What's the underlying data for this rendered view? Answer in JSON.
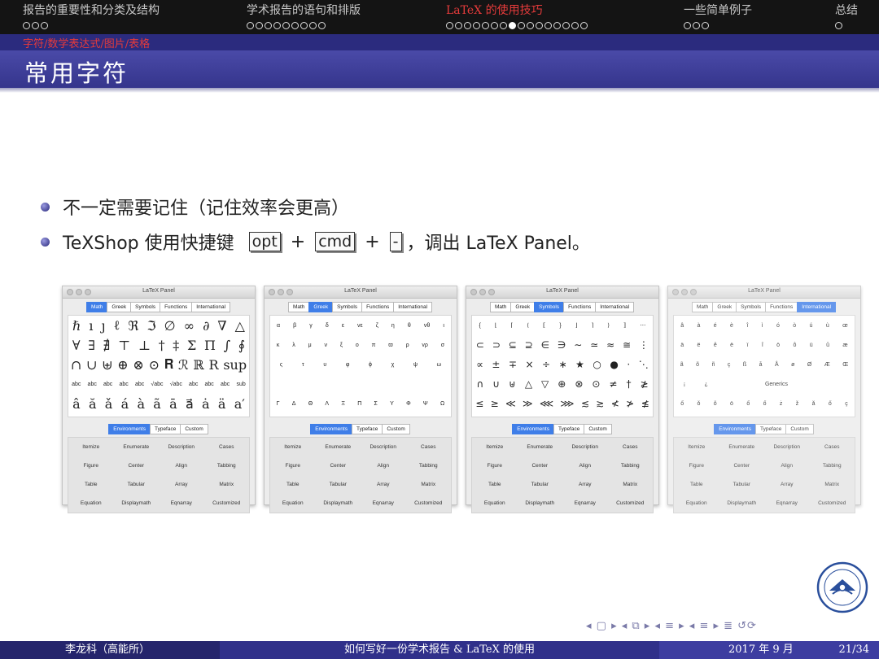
{
  "nav": [
    {
      "title": "报告的重要性和分类及结构",
      "dots": 3,
      "filled": -1
    },
    {
      "title": "学术报告的语句和排版",
      "dots": 9,
      "filled": -1
    },
    {
      "title": "LaTeX 的使用技巧",
      "dots": 16,
      "filled": 7,
      "active": true
    },
    {
      "title": "一些简单例子",
      "dots": 3,
      "filled": -1
    },
    {
      "title": "总结",
      "dots": 1,
      "filled": -1
    }
  ],
  "subsection": "字符/数学表达式/图片/表格",
  "frame_title": "常用字符",
  "bullets": {
    "b1": "不一定需要记住（记住效率会更高）",
    "b2_pre": "TeXShop 使用快捷键",
    "key1": "opt",
    "plus": "+",
    "key2": "cmd",
    "key3": "-",
    "b2_post": "，调出 LaTeX Panel。"
  },
  "panels": [
    {
      "title": "LaTeX Panel",
      "tabs": [
        "Math",
        "Greek",
        "Symbols",
        "Functions",
        "International"
      ],
      "active_tab": 0,
      "rows": [
        {
          "size": "big",
          "items": [
            "ℏ",
            "ı",
            "ȷ",
            "ℓ",
            "ℜ",
            "ℑ",
            "∅",
            "∞",
            "∂",
            "∇",
            "△"
          ]
        },
        {
          "size": "big",
          "items": [
            "∀",
            "∃",
            "∄",
            "⊤",
            "⊥",
            "†",
            "‡",
            "Σ",
            "Π",
            "∫",
            "∮"
          ]
        },
        {
          "size": "big",
          "items": [
            "∩",
            "∪",
            "⊎",
            "⊕",
            "⊗",
            "⊙",
            "𝐑",
            "ℛ",
            "ℝ",
            "R",
            "sup"
          ]
        },
        {
          "size": "small",
          "items": [
            "abc",
            "abc",
            "abc",
            "abc",
            "abc",
            "√abc",
            "√abc",
            "abc",
            "abc",
            "abc",
            "sub"
          ]
        },
        {
          "size": "big",
          "items": [
            "â",
            "ă",
            "ǎ",
            "á",
            "à",
            "ã",
            "ā",
            "a⃗",
            "ȧ",
            "ä",
            "a′"
          ]
        }
      ],
      "env_tabs": [
        "Environments",
        "Typeface",
        "Custom"
      ]
    },
    {
      "title": "LaTeX Panel",
      "tabs": [
        "Math",
        "Greek",
        "Symbols",
        "Functions",
        "International"
      ],
      "active_tab": 1,
      "rows": [
        {
          "size": "small",
          "items": [
            "α",
            "β",
            "γ",
            "δ",
            "ε",
            "vε",
            "ζ",
            "η",
            "θ",
            "vθ",
            "ι"
          ]
        },
        {
          "size": "small",
          "items": [
            "κ",
            "λ",
            "μ",
            "ν",
            "ξ",
            "o",
            "π",
            "ϖ",
            "ρ",
            "vρ",
            "σ"
          ]
        },
        {
          "size": "small",
          "items": [
            "ς",
            "τ",
            "υ",
            "φ",
            "ϕ",
            "χ",
            "ψ",
            "ω"
          ]
        },
        {
          "size": "small",
          "items": []
        },
        {
          "size": "small",
          "items": [
            "Γ",
            "Δ",
            "Θ",
            "Λ",
            "Ξ",
            "Π",
            "Σ",
            "Υ",
            "Φ",
            "Ψ",
            "Ω"
          ]
        }
      ],
      "env_tabs": [
        "Environments",
        "Typeface",
        "Custom"
      ]
    },
    {
      "title": "LaTeX Panel",
      "tabs": [
        "Math",
        "Greek",
        "Symbols",
        "Functions",
        "International"
      ],
      "active_tab": 2,
      "rows": [
        {
          "size": "small",
          "items": [
            "{",
            "⌊",
            "⌈",
            "⟨",
            "⟦",
            "}",
            "⌋",
            "⌉",
            "⟩",
            "⟧",
            "⋯"
          ]
        },
        {
          "size": "mid",
          "items": [
            "⊂",
            "⊃",
            "⊆",
            "⊇",
            "∈",
            "∋",
            "∼",
            "≃",
            "≈",
            "≅",
            "⋮"
          ]
        },
        {
          "size": "mid",
          "items": [
            "∝",
            "±",
            "∓",
            "×",
            "÷",
            "∗",
            "★",
            "○",
            "●",
            "·",
            "⋱"
          ]
        },
        {
          "size": "mid",
          "items": [
            "∩",
            "∪",
            "⊎",
            "△",
            "▽",
            "⊕",
            "⊗",
            "⊙",
            "≠",
            "†",
            "≱"
          ]
        },
        {
          "size": "mid",
          "items": [
            "≤",
            "≥",
            "≪",
            "≫",
            "⋘",
            "⋙",
            "≲",
            "≳",
            "≮",
            "≯",
            "≰"
          ]
        }
      ],
      "env_tabs": [
        "Environments",
        "Typeface",
        "Custom"
      ]
    },
    {
      "title": "LaTeX Panel",
      "tabs": [
        "Math",
        "Greek",
        "Symbols",
        "Functions",
        "International"
      ],
      "active_tab": 4,
      "rows": [
        {
          "size": "small",
          "items": [
            "â",
            "à",
            "é",
            "è",
            "î",
            "ì",
            "ó",
            "ò",
            "ú",
            "ù",
            "œ"
          ]
        },
        {
          "size": "small",
          "items": [
            "ä",
            "ë",
            "ê",
            "ë",
            "ï",
            "î",
            "ö",
            "ô",
            "ü",
            "û",
            "æ"
          ]
        },
        {
          "size": "small",
          "items": [
            "ã",
            "õ",
            "ñ",
            "ç",
            "ß",
            "å",
            "Å",
            "ø",
            "Ø",
            "Æ",
            "Œ"
          ]
        },
        {
          "size": "small",
          "items": [
            "¡",
            "¿",
            "",
            "",
            "Generics",
            "",
            "",
            ""
          ]
        },
        {
          "size": "small",
          "items": [
            "ő",
            "ǒ",
            "ǒ",
            "ö",
            "ő",
            "ő",
            "ż",
            "ž",
            "ă",
            "ő",
            "ç"
          ]
        }
      ],
      "env_tabs": [
        "Environments",
        "Typeface",
        "Custom"
      ]
    }
  ],
  "env_items": [
    "Itemize",
    "Enumerate",
    "Description",
    "Cases",
    "Figure",
    "Center",
    "Align",
    "Tabbing",
    "Table",
    "Tabular",
    "Array",
    "Matrix",
    "Equation",
    "Displaymath",
    "Eqnarray",
    "Customized"
  ],
  "footer": {
    "author": "李龙科（高能所）",
    "title": "如何写好一份学术报告 & LaTeX 的使用",
    "date": "2017 年 9 月",
    "page": "21/34"
  },
  "nav_icons": "◂ ▢ ▸ ◂ ⧉ ▸ ◂ ≡ ▸ ◂ ≡ ▸  ≣  ↺⟳"
}
